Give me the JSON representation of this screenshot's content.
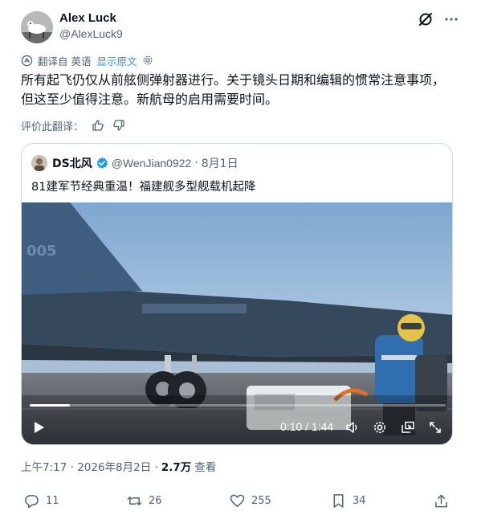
{
  "author": {
    "name": "Alex Luck",
    "handle": "@AlexLuck9"
  },
  "translation": {
    "label": "翻译自 英语",
    "show_original": "显示原文"
  },
  "post": {
    "text": "所有起飞仍仅从前舷侧弹射器进行。关于镜头日期和编辑的惯常注意事项，但这至少值得注意。新航母的启用需要时间。"
  },
  "rate_translation": {
    "label": "评价此翻译："
  },
  "quote": {
    "name": "DS北风",
    "handle": "@WenJian0922",
    "separator": "·",
    "date": "8月1日",
    "text": "81建军节经典重温！福建舰多型舰载机起降",
    "video": {
      "current_time": "0:10",
      "duration": "1:44",
      "time_readout": "0:10 / 1:44",
      "progress": 0.096,
      "hull_marking": "005"
    }
  },
  "meta": {
    "time_date": "上午7:17 · 2026年8月2日 ·",
    "views": "2.7万",
    "views_label": "查看"
  },
  "actions": {
    "replies": "11",
    "reposts": "26",
    "likes": "255",
    "bookmarks": "34"
  },
  "colors": {
    "accent": "#1d9bf0",
    "secondary_text": "#536471",
    "primary_text": "#0f1419"
  }
}
